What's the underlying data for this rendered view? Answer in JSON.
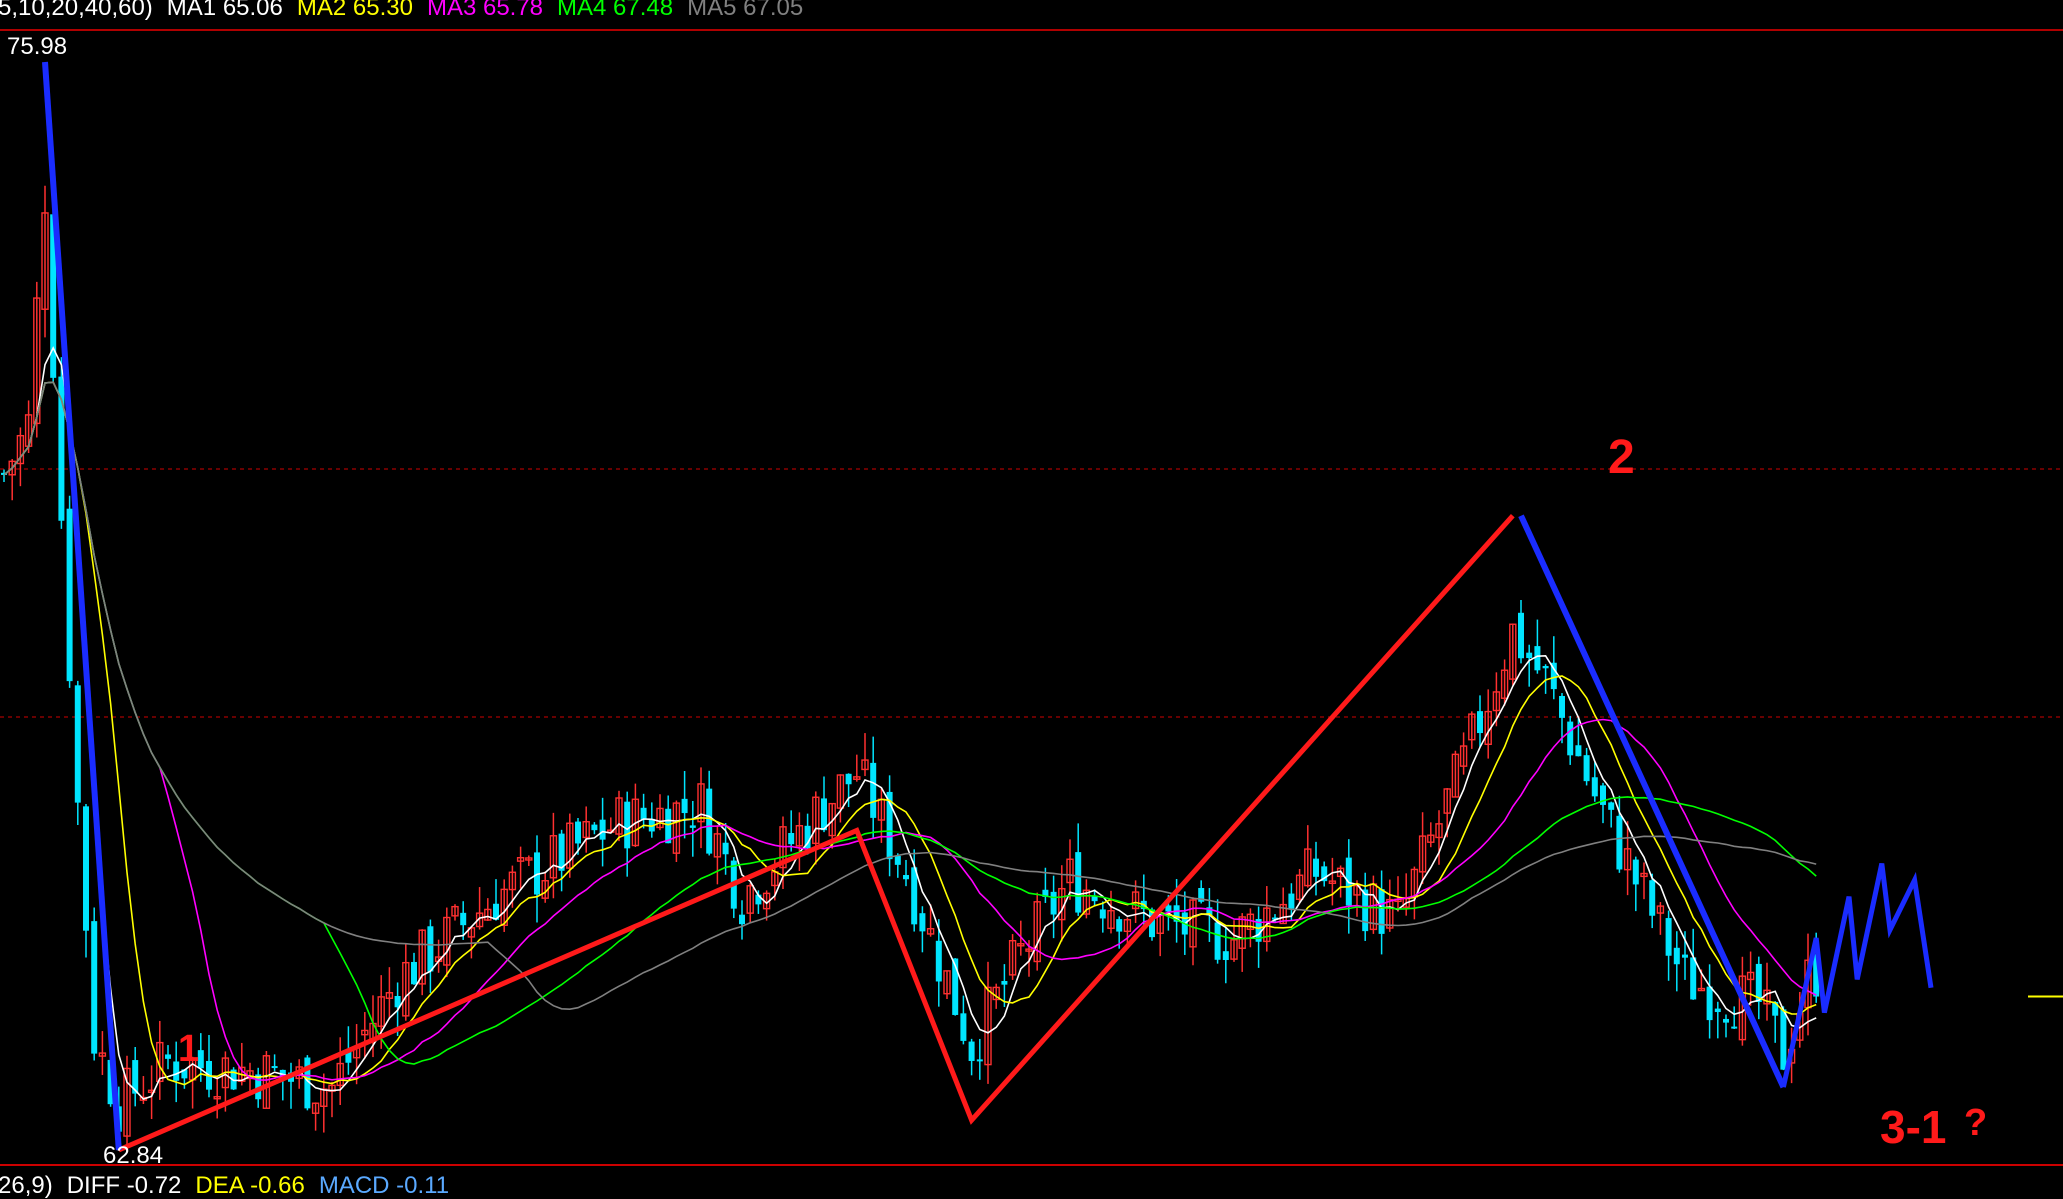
{
  "legend_top": {
    "prefix": "5,10,20,40,60)",
    "items": [
      {
        "label": "MA1 65.06",
        "color": "#ffffff"
      },
      {
        "label": "MA2 65.30",
        "color": "#ffff00"
      },
      {
        "label": "MA3 65.78",
        "color": "#ff00ff"
      },
      {
        "label": "MA4 67.48",
        "color": "#00ff00"
      },
      {
        "label": "MA5 67.05",
        "color": "#808080"
      }
    ]
  },
  "legend_bottom": {
    "prefix": "26,9)",
    "items": [
      {
        "label": "DIFF -0.72",
        "color": "#ffffff"
      },
      {
        "label": "DEA -0.66",
        "color": "#ffff00"
      },
      {
        "label": "MACD -0.11",
        "color": "#5aa9ff"
      }
    ]
  },
  "price_labels": {
    "high": "75.98",
    "low": "62.84"
  },
  "wave_labels": {
    "wave1": "1",
    "wave2": "2",
    "wave3": "3-1",
    "question": "?"
  },
  "colors": {
    "background": "#000000",
    "up_candle": "#ff3030",
    "down_candle": "#00e5ff",
    "wave_red": "#ff1a1a",
    "wave_blue": "#1a2cff",
    "grid_red": "#b00000"
  },
  "chart_data": {
    "type": "candlestick",
    "y_range": [
      62.84,
      75.98
    ],
    "high": 75.98,
    "low": 62.84,
    "bars": 235,
    "moving_averages": [
      {
        "name": "MA1",
        "period": 5,
        "last": 65.06
      },
      {
        "name": "MA2",
        "period": 10,
        "last": 65.3
      },
      {
        "name": "MA3",
        "period": 20,
        "last": 65.78
      },
      {
        "name": "MA4",
        "period": 40,
        "last": 67.48
      },
      {
        "name": "MA5",
        "period": 60,
        "last": 67.05
      }
    ],
    "macd": {
      "diff": -0.72,
      "dea": -0.66,
      "macd": -0.11
    },
    "wave_annotations": {
      "red_zigzag": [
        [
          14,
          62.84
        ],
        [
          104,
          66.7
        ],
        [
          118,
          63.2
        ],
        [
          184,
          70.5
        ]
      ],
      "blue_down_1": [
        [
          5,
          75.98
        ],
        [
          14,
          62.84
        ]
      ],
      "blue_down_2": [
        [
          185,
          70.5
        ],
        [
          217,
          63.6
        ]
      ],
      "blue_projection": [
        [
          217,
          63.6
        ],
        [
          221,
          65.4
        ],
        [
          222,
          64.5
        ],
        [
          225,
          65.9
        ],
        [
          226,
          64.9
        ],
        [
          229,
          66.3
        ],
        [
          230,
          65.5
        ],
        [
          233,
          66.1
        ],
        [
          235,
          64.8
        ]
      ]
    }
  }
}
